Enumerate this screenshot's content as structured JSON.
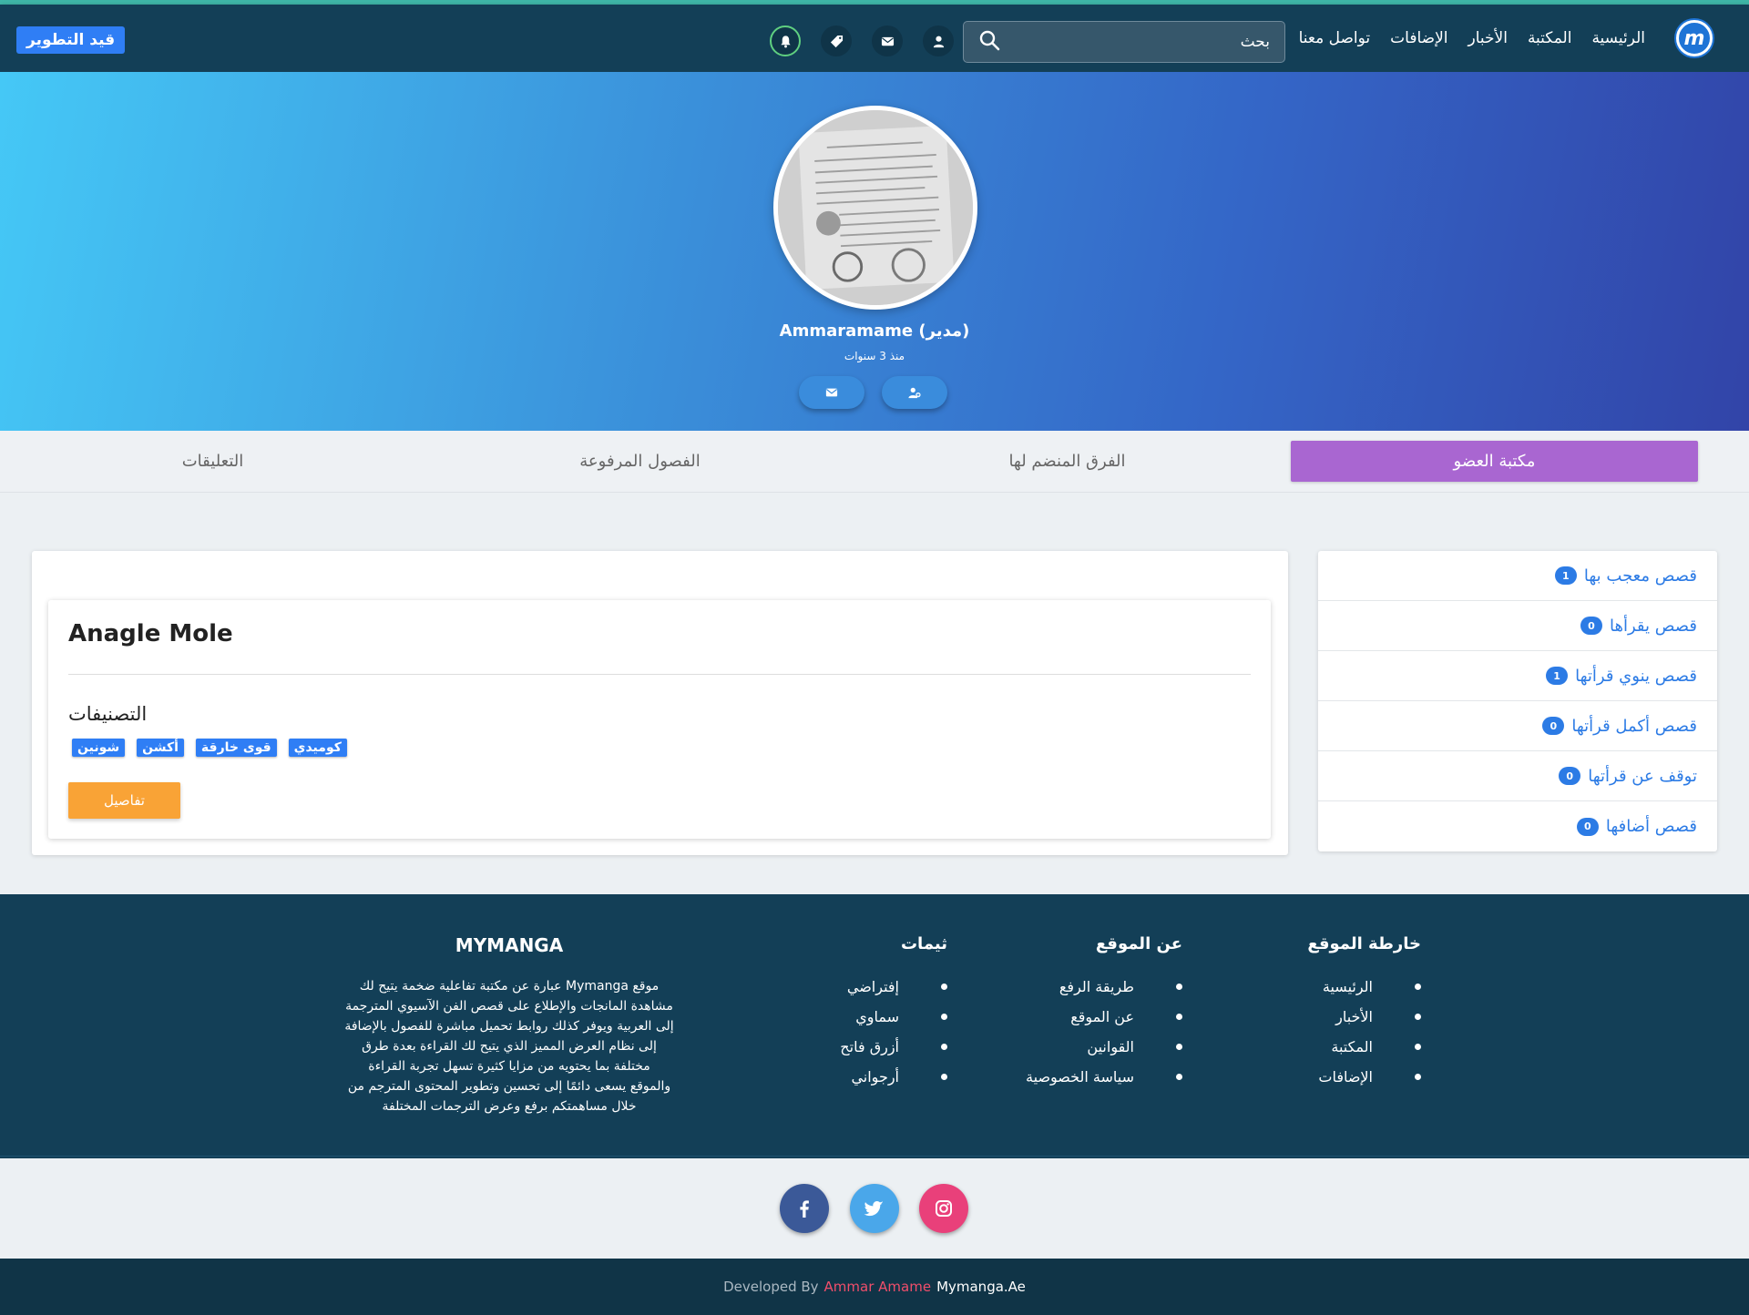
{
  "navbar": {
    "logo_letter": "m",
    "links": [
      "الرئيسية",
      "المكتبة",
      "الأخبار",
      "الإضافات",
      "تواصل معنا"
    ],
    "search_placeholder": "بحث",
    "dev_badge": "قيد التطوير",
    "icons": [
      "search-icon",
      "user-icon",
      "envelope-icon",
      "tag-icon",
      "bell-icon"
    ]
  },
  "profile": {
    "name": "Ammaramame (مدير)",
    "since": "منذ 3 سنوات",
    "buttons": [
      "envelope-icon",
      "follow-user-icon"
    ]
  },
  "tabs": [
    "مكتبة العضو",
    "الفرق المنضم لها",
    "الفصول المرفوعة",
    "التعليقات"
  ],
  "active_tab": "مكتبة العضو",
  "library": {
    "manga_title": "Anagle Mole",
    "categories_heading": "التصنيفات",
    "tags": [
      "كوميدي",
      "قوى خارقة",
      "أكشن",
      "شونين"
    ],
    "details_label": "تفاصيل"
  },
  "side_list": [
    {
      "label": "قصص معجب بها",
      "count": "1"
    },
    {
      "label": "قصص يقرأها",
      "count": "0"
    },
    {
      "label": "قصص ينوي قرأتها",
      "count": "1"
    },
    {
      "label": "قصص أكمل قرأتها",
      "count": "0"
    },
    {
      "label": "توقف عن قرأتها",
      "count": "0"
    },
    {
      "label": "قصص أضافها",
      "count": "0"
    }
  ],
  "footer": {
    "sitemap": {
      "title": "خارطة الموقع",
      "items": [
        "الرئيسية",
        "الأخبار",
        "المكتبة",
        "الإضافات"
      ]
    },
    "about": {
      "title": "عن الموقع",
      "items": [
        "طريقة الرفع",
        "عن الموقع",
        "القوانين",
        "سياسة الخصوصية"
      ]
    },
    "themes": {
      "title": "ثيمات",
      "items": [
        "إفتراضي",
        "سماوي",
        "أزرق فاتح",
        "أرجواني"
      ]
    },
    "brand": {
      "title": "MYMANGA",
      "lines": [
        "موقع Mymanga عبارة عن مكتبة تفاعلية ضخمة يتيح لك",
        "مشاهدة المانجات والإطلاع على قصص الفن الآسيوي المترجمة",
        "إلى العربية ويوفر كذلك روابط تحميل مباشرة للفصول بالإضافة",
        "إلى نظام العرض المميز الذي يتيح لك القراءة بعدة طرق",
        "مختلفة بما يحتويه من مزايا كثيرة تسهل تجربة القراءة",
        "والموقع يسعى دائمًا إلى تحسين وتطوير المحتوى المترجم من",
        "خلال مساهمتكم برفع وعرض الترجمات المختلفة"
      ]
    },
    "social": [
      "instagram-icon",
      "twitter-icon",
      "facebook-icon"
    ],
    "colors": {
      "instagram": "#e9407a",
      "twitter": "#4aa7ea",
      "facebook": "#3b5998"
    },
    "credit_prefix": "Developed By",
    "credit_author": "Ammar Amame",
    "credit_site": "Mymanga.Ae"
  }
}
